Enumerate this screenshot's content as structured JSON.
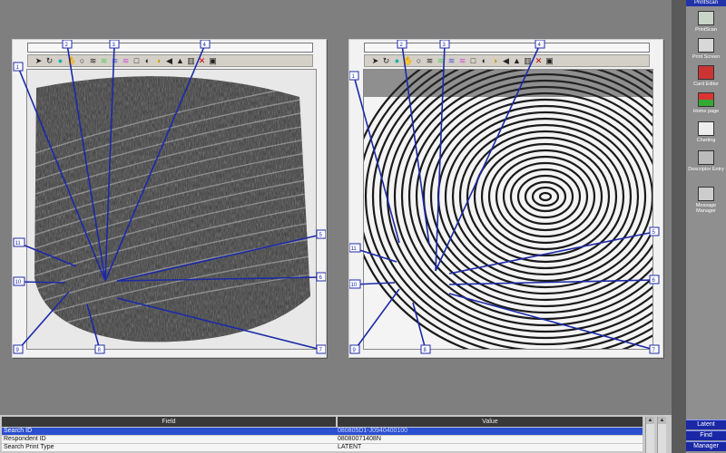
{
  "colors": {
    "marker_line": "#1c2aa8",
    "selected_row": "#2b4fd1",
    "side_button": "#1a28a6"
  },
  "toolbar_icons": [
    "pointer-icon",
    "rotate-icon",
    "zoom-icon",
    "hand-icon",
    "circle-icon",
    "ridge-icon",
    "ridge2-icon",
    "ridge3-icon",
    "ridge4-icon",
    "square-icon",
    "contrast-icon",
    "brightness-icon",
    "sharpen-icon",
    "level-icon",
    "film-icon",
    "delete-icon",
    "export-icon"
  ],
  "left_panel": {
    "markers": [
      {
        "label": "1"
      },
      {
        "label": "2"
      },
      {
        "label": "3"
      },
      {
        "label": "4"
      },
      {
        "label": "5"
      },
      {
        "label": "6"
      },
      {
        "label": "7"
      },
      {
        "label": "8"
      },
      {
        "label": "9"
      },
      {
        "label": "10"
      },
      {
        "label": "11"
      }
    ]
  },
  "right_panel": {
    "markers": [
      {
        "label": "1"
      },
      {
        "label": "2"
      },
      {
        "label": "3"
      },
      {
        "label": "4"
      },
      {
        "label": "5"
      },
      {
        "label": "6"
      },
      {
        "label": "7"
      },
      {
        "label": "8"
      },
      {
        "label": "9"
      },
      {
        "label": "10"
      },
      {
        "label": "11"
      }
    ]
  },
  "table": {
    "headers": {
      "field": "Field",
      "value": "Value"
    },
    "rows": [
      {
        "field": "Search ID",
        "value": "080805D1-J0940400100"
      },
      {
        "field": "Respondent ID",
        "value": "08080071408N"
      },
      {
        "field": "Search Print Type",
        "value": "LATENT"
      }
    ]
  },
  "sidebar": {
    "top_label": "PrintScan",
    "items": [
      {
        "label": "PrintScan",
        "icon": "scanner-icon"
      },
      {
        "label": "Print Screen",
        "icon": "print-screen-icon"
      },
      {
        "label": "Card Editor",
        "icon": "card-editor-icon"
      },
      {
        "label": "Home page",
        "icon": "home-page-icon"
      },
      {
        "label": "Charting",
        "icon": "charting-icon"
      },
      {
        "label": "Descriptor Entry",
        "icon": "descriptor-entry-icon"
      },
      {
        "label": "Message Manager",
        "icon": "message-manager-icon"
      }
    ],
    "buttons": {
      "latent": "Latent",
      "find": "Find",
      "manager": "Manager"
    }
  }
}
